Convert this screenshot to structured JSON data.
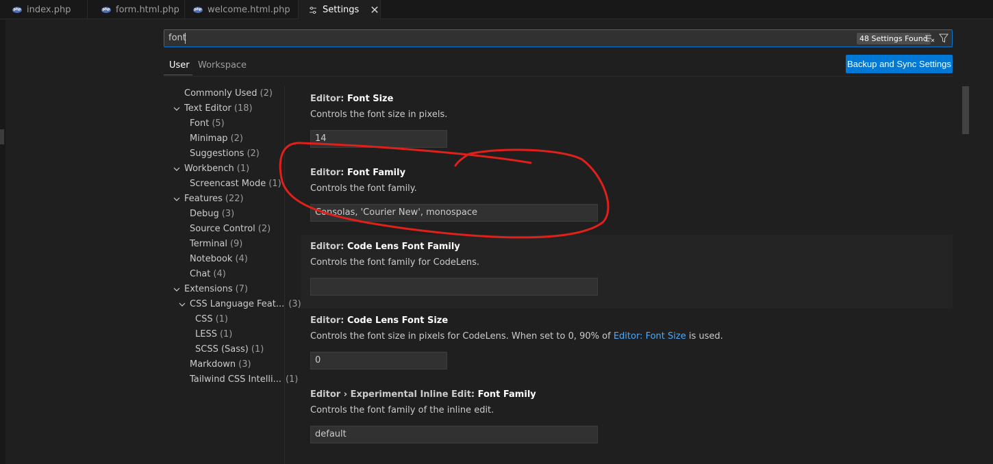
{
  "tabs": [
    {
      "label": "index.php",
      "icon": "php-file-icon"
    },
    {
      "label": "form.html.php",
      "icon": "php-file-icon"
    },
    {
      "label": "welcome.html.php",
      "icon": "php-file-icon"
    },
    {
      "label": "Settings",
      "icon": "settings-icon",
      "active": true
    }
  ],
  "search": {
    "value": "font",
    "results_badge": "48 Settings Found"
  },
  "scope_tabs": [
    "User",
    "Workspace"
  ],
  "sync_button": "Backup and Sync Settings",
  "toc": [
    {
      "label": "Commonly Used",
      "count": "(2)"
    },
    {
      "label": "Text Editor",
      "count": "(18)",
      "expanded": true
    },
    {
      "label": "Font",
      "count": "(5)"
    },
    {
      "label": "Minimap",
      "count": "(2)"
    },
    {
      "label": "Suggestions",
      "count": "(2)"
    },
    {
      "label": "Workbench",
      "count": "(1)",
      "expanded": true
    },
    {
      "label": "Screencast Mode",
      "count": "(1)"
    },
    {
      "label": "Features",
      "count": "(22)",
      "expanded": true
    },
    {
      "label": "Debug",
      "count": "(3)"
    },
    {
      "label": "Source Control",
      "count": "(2)"
    },
    {
      "label": "Terminal",
      "count": "(9)"
    },
    {
      "label": "Notebook",
      "count": "(4)"
    },
    {
      "label": "Chat",
      "count": "(4)"
    },
    {
      "label": "Extensions",
      "count": "(7)",
      "expanded": true
    },
    {
      "label": "CSS Language Feat...",
      "count": "(3)",
      "expanded": true
    },
    {
      "label": "CSS",
      "count": "(1)"
    },
    {
      "label": "LESS",
      "count": "(1)"
    },
    {
      "label": "SCSS (Sass)",
      "count": "(1)"
    },
    {
      "label": "Markdown",
      "count": "(3)"
    },
    {
      "label": "Tailwind CSS Intelli...",
      "count": "(1)"
    }
  ],
  "settings": [
    {
      "category": "Editor: ",
      "name": "Font Size",
      "description": "Controls the font size in pixels.",
      "value": "14"
    },
    {
      "category": "Editor: ",
      "name": "Font Family",
      "description": "Controls the font family.",
      "value": "Consolas, 'Courier New', monospace"
    },
    {
      "category": "Editor: ",
      "name": "Code Lens Font Family",
      "description": "Controls the font family for CodeLens.",
      "value": ""
    },
    {
      "category": "Editor: ",
      "name": "Code Lens Font Size",
      "description_pre": "Controls the font size in pixels for CodeLens. When set to 0, 90% of ",
      "description_link": "Editor: Font Size",
      "description_post": " is used.",
      "value": "0"
    },
    {
      "category": "Editor › Experimental Inline Edit: ",
      "name": "Font Family",
      "description": "Controls the font family of the inline edit.",
      "value": "default"
    }
  ],
  "colors": {
    "accent": "#0078d4",
    "annotation": "#e0201b",
    "link": "#4daafc"
  }
}
